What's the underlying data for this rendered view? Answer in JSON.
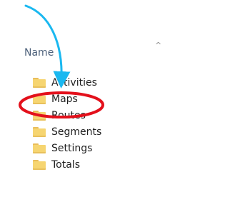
{
  "header": {
    "name_column": "Name",
    "sort_indicator": "^"
  },
  "items": [
    {
      "label": "Activities",
      "icon": "folder-icon"
    },
    {
      "label": "Maps",
      "icon": "folder-icon"
    },
    {
      "label": "Routes",
      "icon": "folder-icon"
    },
    {
      "label": "Segments",
      "icon": "folder-icon"
    },
    {
      "label": "Settings",
      "icon": "folder-icon"
    },
    {
      "label": "Totals",
      "icon": "folder-icon"
    }
  ],
  "annotation": {
    "arrow_color": "#1ab8f0",
    "circle_color": "#e3101b",
    "highlighted_item": "Maps"
  }
}
